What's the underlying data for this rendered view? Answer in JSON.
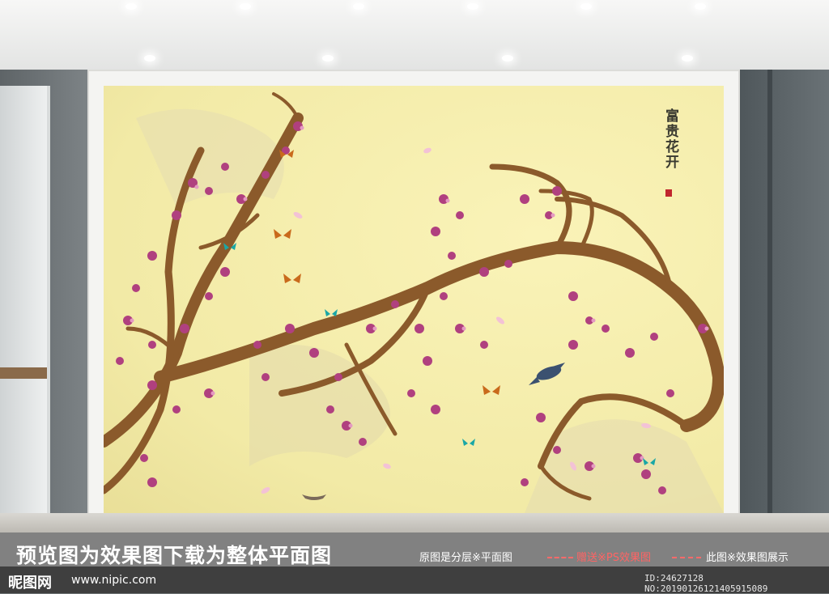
{
  "scene": {
    "wall_color": "#6f7375",
    "mural_background": "#f4eca9",
    "blossom_color": "#b0407f",
    "branch_color": "#8b5a2b"
  },
  "mural": {
    "title_glyphs": "富贵花开",
    "seal": "印"
  },
  "watermark": {
    "preview_note": "预览图为效果图下载为整体平面图",
    "layer_note": "原图是分层※平面图",
    "gift_note": "赠送※PS效果图",
    "effect_note": "此图※效果图展示"
  },
  "footer": {
    "site_logo": "昵图网",
    "site_url": "www.nipic.com",
    "id_text": "ID:24627128 NO:20190126121405915089"
  }
}
